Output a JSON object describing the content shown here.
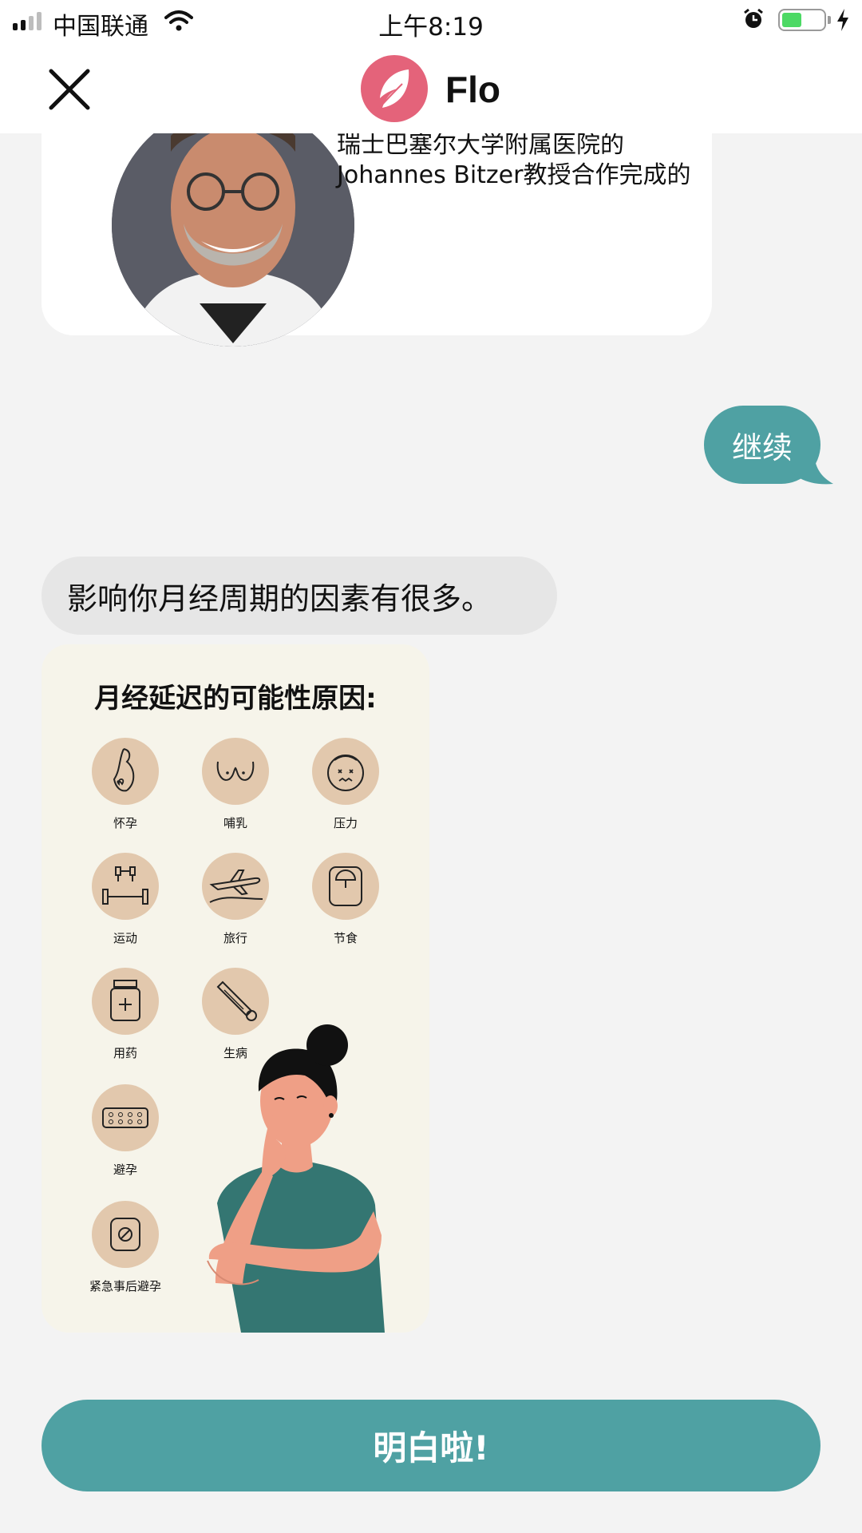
{
  "status_bar": {
    "carrier": "中国联通",
    "time": "上午8:19"
  },
  "header": {
    "title": "Flo",
    "close_icon": "close-icon",
    "logo_icon": "feather-logo"
  },
  "doctor_card": {
    "line1": "瑞士巴塞尔大学附属医院的",
    "line2": "Johannes Bitzer教授合作完成的"
  },
  "messages": {
    "user_reply": "继续",
    "bot_message": "影响你月经周期的因素有很多。"
  },
  "infographic": {
    "title": "月经延迟的可能性原因:",
    "factors": [
      {
        "label": "怀孕",
        "icon": "pregnancy-icon"
      },
      {
        "label": "哺乳",
        "icon": "breastfeeding-icon"
      },
      {
        "label": "压力",
        "icon": "stress-icon"
      },
      {
        "label": "运动",
        "icon": "dumbbell-icon"
      },
      {
        "label": "旅行",
        "icon": "airplane-icon"
      },
      {
        "label": "节食",
        "icon": "scale-icon"
      },
      {
        "label": "用药",
        "icon": "medicine-bottle-icon"
      },
      {
        "label": "生病",
        "icon": "thermometer-icon"
      },
      {
        "label": "避孕",
        "icon": "pill-pack-icon"
      },
      {
        "label": "紧急事后避孕",
        "icon": "single-pill-icon"
      }
    ]
  },
  "cta": {
    "label": "明白啦!"
  },
  "colors": {
    "teal": "#4fa1a3",
    "brand_pink": "#e4637a",
    "icon_circle": "#e2c8ad",
    "infographic_bg": "#f6f4ea"
  }
}
